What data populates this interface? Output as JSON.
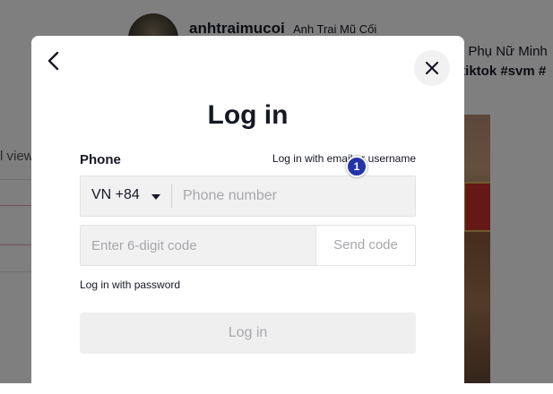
{
  "background": {
    "username": "anhtraimucoi",
    "display_name": "Anh Trai Mũ Cối",
    "caption_line1": "ời Phụ Nữ Minh",
    "caption_line2": "gtiktok #svm #",
    "side_text": "l view"
  },
  "modal": {
    "title": "Log in",
    "phone_label": "Phone",
    "email_link": "Log in with email or username",
    "country_code": "VN +84",
    "phone_placeholder": "Phone number",
    "code_placeholder": "Enter 6-digit code",
    "send_code_label": "Send code",
    "password_link": "Log in with password",
    "login_button": "Log in"
  },
  "annotation": {
    "marker_label": "1"
  },
  "colors": {
    "text": "#161823",
    "input_bg": "#f1f1f2",
    "disabled_text": "#a7a7ab",
    "marker": "#2434a8"
  }
}
